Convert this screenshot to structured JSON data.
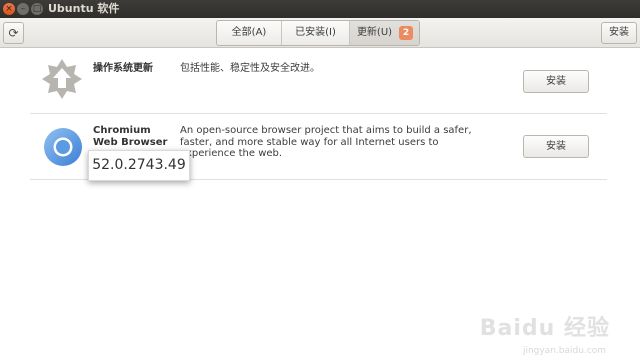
{
  "window": {
    "title": "Ubuntu 软件",
    "close_glyph": "×",
    "min_glyph": "–",
    "max_glyph": "□"
  },
  "toolbar": {
    "refresh_glyph": "⟳",
    "tabs": [
      {
        "label": "全部(A)"
      },
      {
        "label": "已安装(I)"
      },
      {
        "label": "更新(U)",
        "badge": "2"
      }
    ],
    "install_label": "安装"
  },
  "updates": [
    {
      "name": "操作系统更新",
      "description": "包括性能、稳定性及安全改进。",
      "button": "安装",
      "icon": "os-update-icon"
    },
    {
      "name": "Chromium Web Browser",
      "description": "An open-source browser project that aims to build a safer, faster, and more stable way for all Internet users to experience the web.",
      "button": "安装",
      "icon": "chromium-icon"
    }
  ],
  "tooltip": {
    "text": "52.0.2743.49"
  },
  "watermark": {
    "text": "Baidu 经验",
    "sub": "jingyan.baidu.com"
  },
  "colors": {
    "accent": "#ec8a60",
    "titlebar": "#3d3c38"
  }
}
